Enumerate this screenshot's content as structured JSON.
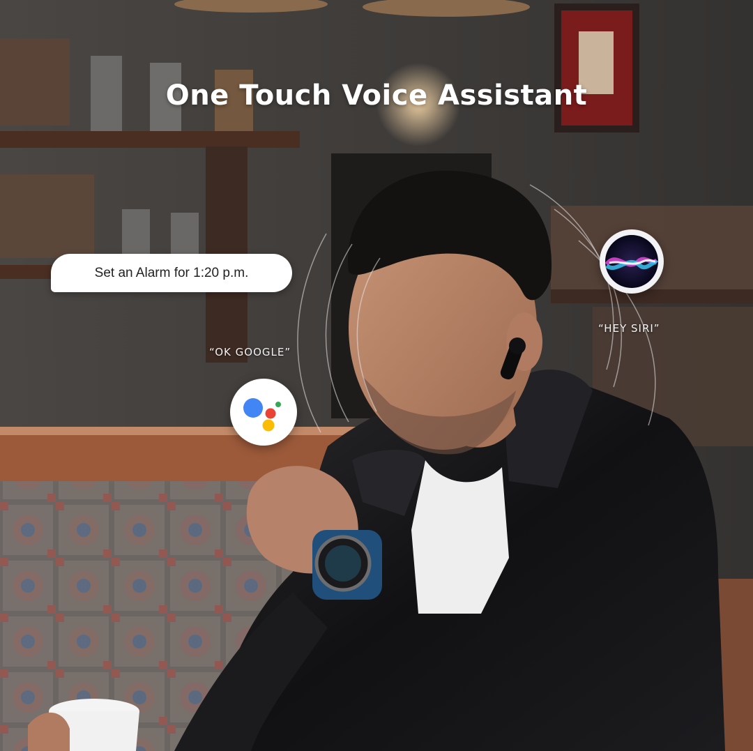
{
  "headline": "One Touch Voice Assistant",
  "speech_bubble": "Set an Alarm for 1:20 p.m.",
  "assistants": {
    "google": {
      "command": "“OK GOOGLE”",
      "icon": "google-assistant-icon",
      "colors": {
        "blue": "#4285F4",
        "red": "#EA4335",
        "yellow": "#FBBC05",
        "green": "#34A853"
      }
    },
    "siri": {
      "command": "“HEY SIRI”",
      "icon": "siri-icon"
    }
  }
}
